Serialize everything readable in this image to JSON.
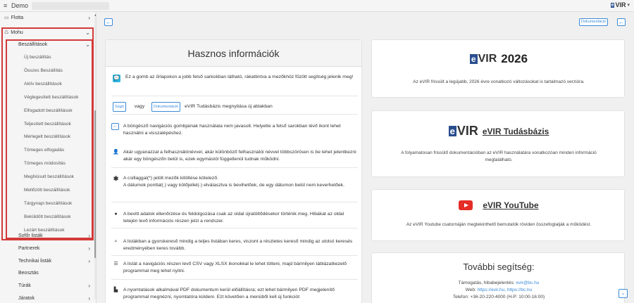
{
  "topbar": {
    "menu_icon": "≡",
    "title": "Demo",
    "logo_e": "e",
    "logo_text": "VIR",
    "logo_caret": "▾"
  },
  "sidebar": {
    "flotta": "Flotta",
    "mohu": "Mohu",
    "beszallitasok": "Beszállítások",
    "sub_items": [
      "Új beszállítás",
      "Összes Beszállítás",
      "Aktív beszállítások",
      "Véglegesített beszállítások",
      "Elfogadott beszállítások",
      "Teljesített beszállítások",
      "Mérlegelt beszállítások",
      "Tömeges elfogadás",
      "Tömeges módosítás",
      "Meghiúsult beszállítások",
      "Mellőzött beszállítások",
      "Tárgynapi beszállítások",
      "Beküldött beszállítások",
      "Lezárt beszállítások"
    ],
    "bottom_items": [
      {
        "label": "Sofőr listák",
        "arrow": "›"
      },
      {
        "label": "Partnerek",
        "arrow": "›"
      },
      {
        "label": "Technikai listák",
        "arrow": "›"
      },
      {
        "label": "Beosztás",
        "arrow": ""
      },
      {
        "label": "Túrák",
        "arrow": "›"
      },
      {
        "label": "Járatok",
        "arrow": "›"
      }
    ]
  },
  "main": {
    "back_icon": "←",
    "doc_button": "Dokumentáció",
    "info": {
      "title": "Hasznos információk",
      "help_text": "Ez a gomb az űrlapokon a jobb felső sarkokban látható, rákattintva a mezőkhöz fűzött segítség jelenik meg!",
      "sugo_tag": "Súgó",
      "vagy": "vagy",
      "doc_tag": "Dokumentáció",
      "kb_text": "eVIR Tudásbázis megnyitása új ablakban",
      "back_text": "A böngésző navigációs gombjainak használata nem javasolt. Helyette a felső sarokban lévő ikont lehet használni a visszalépéshez.",
      "user_text": "Akár ugyanazzal a felhasználónévvel, akár különböző felhasználói névvel többszörösen is be lehet jelentkezni akár egy böngészőn belül is, ezek egymástól függetlenül tudnak működni.",
      "asterisk_text_1": "A csillaggal(*) jelölt mezők kitöltése kötelező.",
      "asterisk_text_2": "A dátumok ponttal(.) vagy kötőjellel(-) elválasztva is bevihetőek, de egy dátumon belül nem keverhetőek.",
      "info_text": "A bevitt adatok ellenőrzése és feldolgozása csak az oldal újratöltődésekor történik meg. Hibákat az oldal tetején levő információs részen jelzi a rendszer.",
      "search_text": "A listákban a gyorskereső mindig a teljes listában keres, viszont a részletes kereső mindig az utolsó keresés eredményében keres tovább.",
      "list_text": "A listát a navigációs részen levő CSV vagy XLSX ikonokkal le lehet tölteni, majd bármilyen táblázatkezelő programmal meg lehet nyitni.",
      "print_text": "A nyomtatások alkalmával PDF dokumentum kerül előállításra; ezt lehet bármilyen PDF megjelenítő programmal megnézni, nyomtatóra küldeni. Ezt követően a menüből kell új funkciót"
    },
    "evir2026": {
      "year": "2026",
      "desc": "Az eVIR frissült a legújabb, 2026 évre vonatkozó változásokat is tartalmazó verzióra."
    },
    "tudasbazis": {
      "title": "eVIR Tudásbázis",
      "desc": "A folyamatosan frissülő dokumentációban az eVIR használatára vonatkozóan minden információ megtalálható."
    },
    "youtube": {
      "title": "eVIR YouTube",
      "desc": "Az eVIR Youtube csatornáján megtekinthető bemutatók röviden összefoglalják a működést."
    },
    "tovabbi": {
      "title": "További segítség:",
      "support_label": "Támogatás, hibabejelentés: ",
      "support_email": "evir@bc.hu",
      "web_label": "Web: ",
      "web_links": "https://evir.hu, https://bc.hu",
      "phone": "Telefon: +36-20-220-4000 (H-P: 10:00-16:00)"
    }
  }
}
